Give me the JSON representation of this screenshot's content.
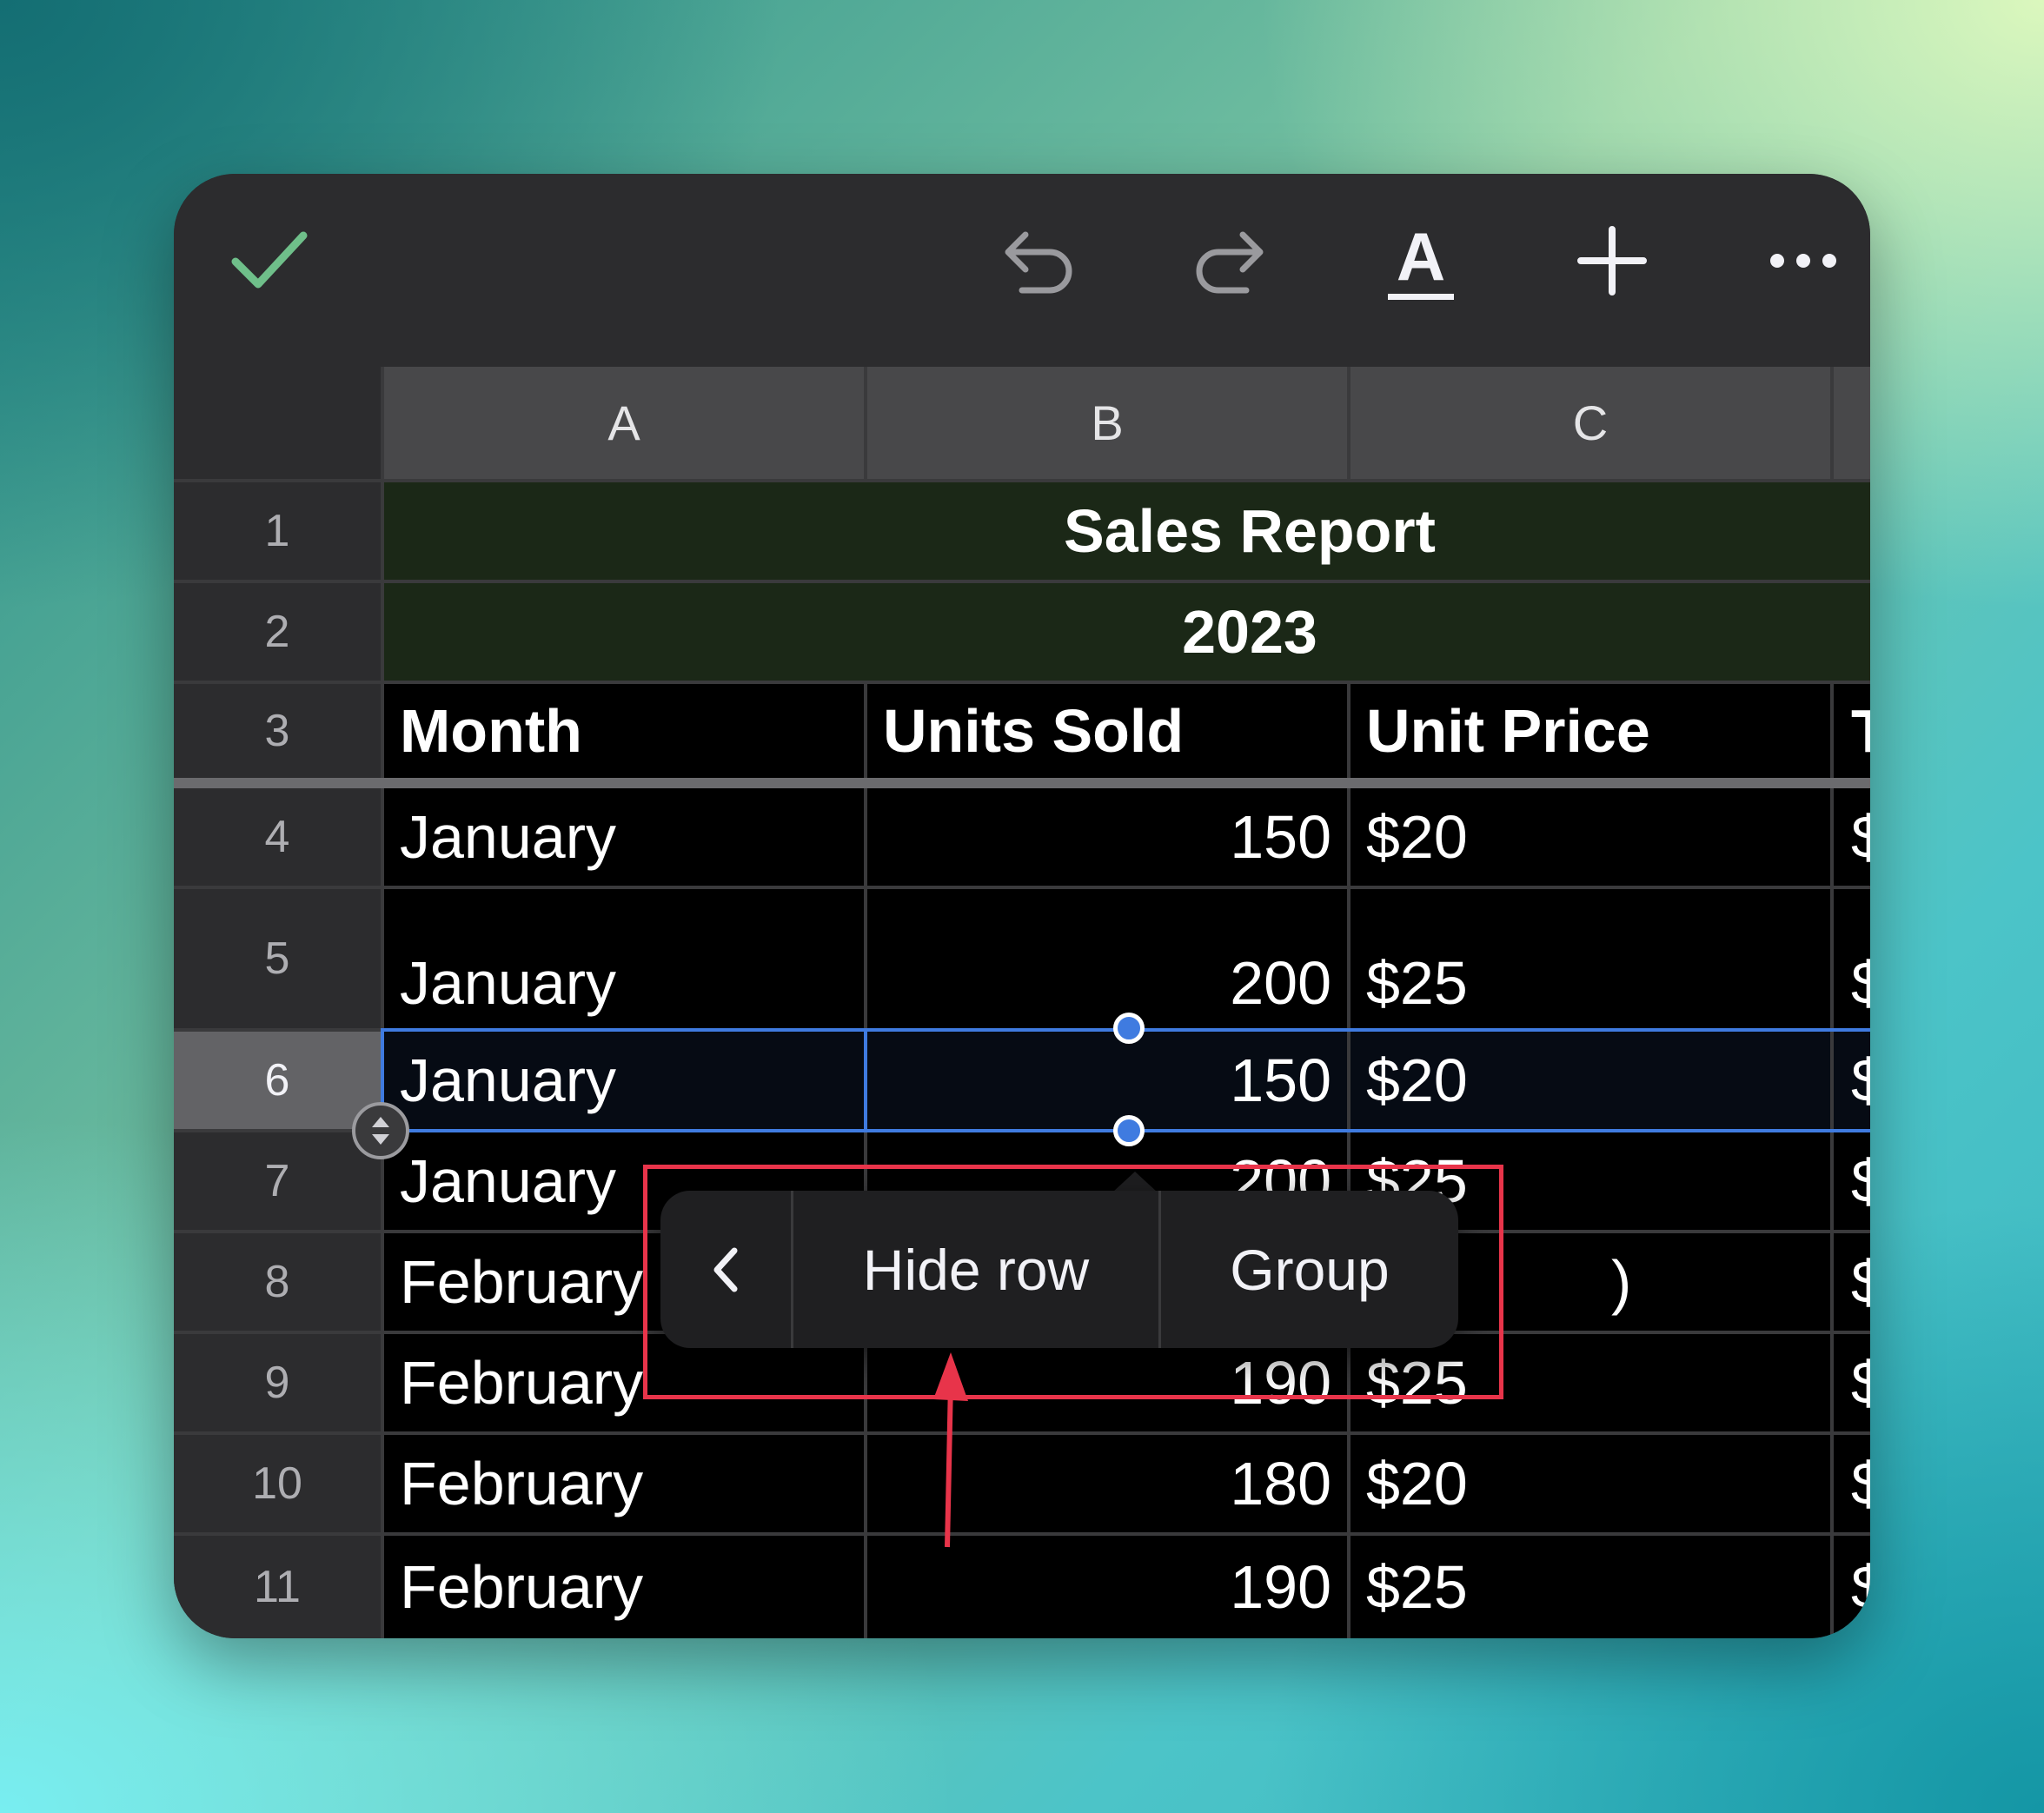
{
  "toolbar": {
    "done_icon": "checkmark-icon",
    "undo_icon": "undo-icon",
    "redo_icon": "redo-icon",
    "format_label": "A",
    "add_icon": "plus-icon",
    "more_icon": "ellipsis-icon"
  },
  "columns": [
    "A",
    "B",
    "C"
  ],
  "rows": [
    {
      "num": "1",
      "cells": [
        "Sales Report"
      ]
    },
    {
      "num": "2",
      "cells": [
        "2023"
      ]
    },
    {
      "num": "3",
      "cells": [
        "Month",
        "Units Sold",
        "Unit Price",
        "T"
      ]
    },
    {
      "num": "4",
      "cells": [
        "January",
        "150",
        "$20",
        "$"
      ]
    },
    {
      "num": "5",
      "cells": [
        "January",
        "200",
        "$25",
        "$"
      ]
    },
    {
      "num": "6",
      "cells": [
        "January",
        "150",
        "$20",
        "$"
      ]
    },
    {
      "num": "7",
      "cells": [
        "January",
        "200",
        "$25",
        "$"
      ]
    },
    {
      "num": "8",
      "cells": [
        "February",
        "",
        ")",
        "$"
      ]
    },
    {
      "num": "9",
      "cells": [
        "February",
        "190",
        "$25",
        "$"
      ]
    },
    {
      "num": "10",
      "cells": [
        "February",
        "180",
        "$20",
        "$"
      ]
    },
    {
      "num": "11",
      "cells": [
        "February",
        "190",
        "$25",
        "$"
      ]
    }
  ],
  "context_menu": {
    "back_icon": "chevron-left-icon",
    "hide_row": "Hide row",
    "group": "Group"
  },
  "colors": {
    "accent": "#3f7be0",
    "check": "#6fbf8a",
    "annotation": "#e8344a",
    "title_fill": "#1b2817"
  }
}
